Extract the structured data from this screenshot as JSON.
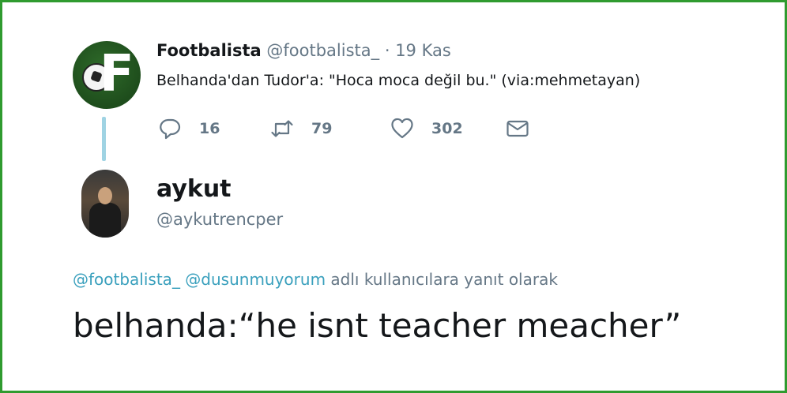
{
  "tweet1": {
    "name": "Footbalista",
    "handle": "@footbalista_",
    "separator": "·",
    "date": "19 Kas",
    "text": "Belhanda'dan Tudor'a: \"Hoca moca değil bu.\" (via:mehmetayan)",
    "avatar_letter": "F",
    "replies": "16",
    "retweets": "79",
    "likes": "302"
  },
  "reply_tweet": {
    "name": "aykut",
    "handle": "@aykutrencper",
    "reply_to": {
      "mention1": "@footbalista_",
      "mention2": "@dusunmuyorum",
      "suffix": "adlı kullanıcılara yanıt olarak"
    },
    "text": "belhanda:“he isnt teacher meacher”"
  },
  "colors": {
    "frame_border": "#2f9b2f",
    "icon_gray": "#657786",
    "mention_blue": "#3aa0bd",
    "thread_line": "#9fd3e3"
  },
  "icons": {
    "reply": "reply-icon",
    "retweet": "retweet-icon",
    "like": "heart-icon",
    "message": "envelope-icon"
  }
}
